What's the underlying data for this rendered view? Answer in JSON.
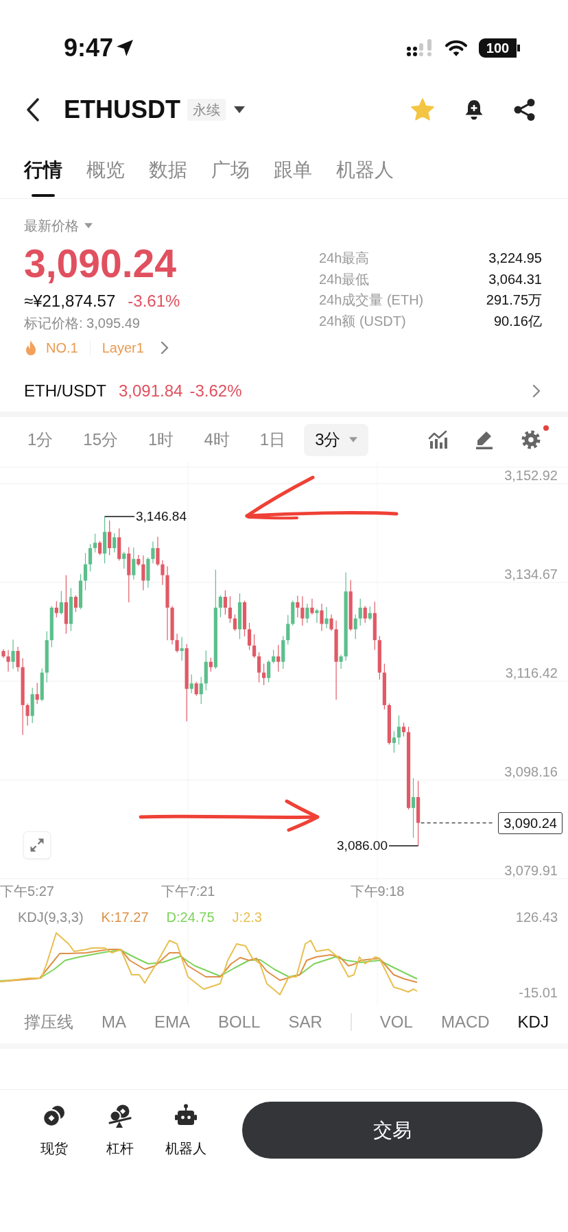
{
  "status_bar": {
    "time": "9:47",
    "battery": "100"
  },
  "header": {
    "symbol": "ETHUSDT",
    "badge": "永续",
    "favorite": true
  },
  "tabs": [
    {
      "label": "行情",
      "selected": true
    },
    {
      "label": "概览",
      "selected": false
    },
    {
      "label": "数据",
      "selected": false
    },
    {
      "label": "广场",
      "selected": false
    },
    {
      "label": "跟单",
      "selected": false
    },
    {
      "label": "机器人",
      "selected": false
    }
  ],
  "price": {
    "label": "最新价格",
    "last": "3,090.24",
    "cny": "≈¥21,874.57",
    "change": "-3.61%",
    "mark": "标记价格: 3,095.49",
    "tags": [
      {
        "kind": "rank",
        "text": "NO.1"
      },
      {
        "kind": "sector",
        "text": "Layer1"
      }
    ]
  },
  "stats": [
    {
      "label": "24h最高",
      "value": "3,224.95"
    },
    {
      "label": "24h最低",
      "value": "3,064.31"
    },
    {
      "label": "24h成交量 (ETH)",
      "value": "291.75万"
    },
    {
      "label": "24h额 (USDT)",
      "value": "90.16亿"
    }
  ],
  "spot": {
    "pair": "ETH/USDT",
    "price": "3,091.84",
    "change": "-3.62%"
  },
  "intervals": [
    {
      "label": "1分",
      "kind": "option",
      "selected": false
    },
    {
      "label": "15分",
      "kind": "option",
      "selected": false
    },
    {
      "label": "1时",
      "kind": "option",
      "selected": false
    },
    {
      "label": "4时",
      "kind": "option",
      "selected": false
    },
    {
      "label": "1日",
      "kind": "option",
      "selected": false
    },
    {
      "label": "3分",
      "kind": "dropdown",
      "selected": true
    }
  ],
  "chart_tools": {
    "settings_alert": true
  },
  "chart": {
    "y_labels": [
      "3,152.92",
      "3,134.67",
      "3,116.42",
      "3,098.16",
      "3,079.91"
    ],
    "x_labels": [
      "下午5:27",
      "下午7:21",
      "下午9:18"
    ],
    "high_label": "3,146.84",
    "low_label": "3,086.00",
    "last_price": "3,090.24"
  },
  "kdj": {
    "title": "KDJ(9,3,3)",
    "lines": [
      {
        "text": "K:17.27",
        "color": "#de9046"
      },
      {
        "text": "D:24.75",
        "color": "#7dd35a"
      },
      {
        "text": "J:2.3",
        "color": "#e8bf4e"
      }
    ],
    "y_max": "126.43",
    "y_min": "-15.01"
  },
  "indicators": [
    {
      "label": "撑压线",
      "divider_before": false,
      "selected": false
    },
    {
      "label": "MA",
      "divider_before": false,
      "selected": false
    },
    {
      "label": "EMA",
      "divider_before": false,
      "selected": false
    },
    {
      "label": "BOLL",
      "divider_before": false,
      "selected": false
    },
    {
      "label": "SAR",
      "divider_before": false,
      "selected": false
    },
    {
      "label": "VOL",
      "divider_before": true,
      "selected": false
    },
    {
      "label": "MACD",
      "divider_before": false,
      "selected": false
    },
    {
      "label": "KDJ",
      "divider_before": false,
      "selected": true
    }
  ],
  "bottom_bar": {
    "items": [
      {
        "label": "现货",
        "kind": "spot"
      },
      {
        "label": "杠杆",
        "kind": "margin"
      },
      {
        "label": "机器人",
        "kind": "robot"
      }
    ],
    "trade": "交易"
  }
}
